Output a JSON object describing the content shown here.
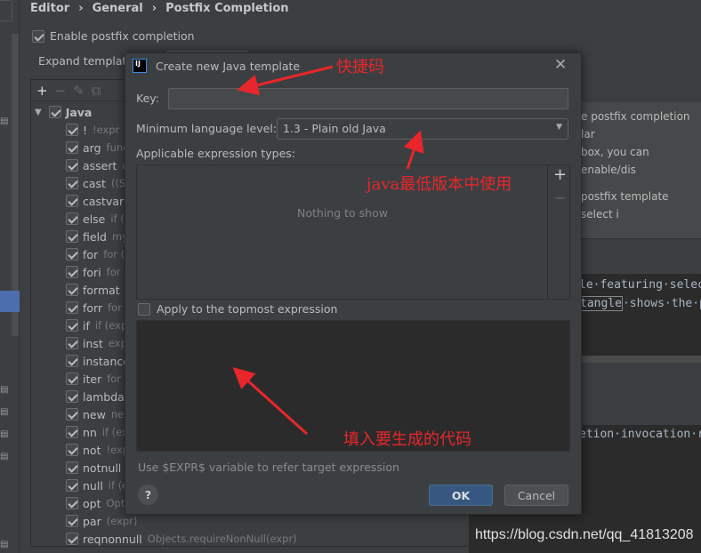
{
  "breadcrumb": [
    "Editor",
    "General",
    "Postfix Completion"
  ],
  "settings": {
    "enable_label": "Enable postfix completion",
    "enable_checked": true,
    "expand_label": "Expand template"
  },
  "tree": {
    "root": "Java",
    "items": [
      {
        "key": "!",
        "desc": "!expr"
      },
      {
        "key": "arg",
        "desc": "func"
      },
      {
        "key": "assert",
        "desc": "a"
      },
      {
        "key": "cast",
        "desc": "((Sc"
      },
      {
        "key": "castvar",
        "desc": "T"
      },
      {
        "key": "else",
        "desc": "if (!e"
      },
      {
        "key": "field",
        "desc": "my"
      },
      {
        "key": "for",
        "desc": "for (T"
      },
      {
        "key": "fori",
        "desc": "for ("
      },
      {
        "key": "format",
        "desc": "S"
      },
      {
        "key": "forr",
        "desc": "for ("
      },
      {
        "key": "if",
        "desc": "if (expr"
      },
      {
        "key": "inst",
        "desc": "expr"
      },
      {
        "key": "instanceof",
        "desc": ""
      },
      {
        "key": "iter",
        "desc": "for ("
      },
      {
        "key": "lambda",
        "desc": ""
      },
      {
        "key": "new",
        "desc": "new"
      },
      {
        "key": "nn",
        "desc": "if (exp"
      },
      {
        "key": "not",
        "desc": "!expr"
      },
      {
        "key": "notnull",
        "desc": "i"
      },
      {
        "key": "null",
        "desc": "if (ex"
      },
      {
        "key": "opt",
        "desc": "Opti"
      },
      {
        "key": "par",
        "desc": "(expr)"
      },
      {
        "key": "reqnonnull",
        "desc": "Objects.requireNonNull(expr)"
      }
    ]
  },
  "description": {
    "lines": [
      "e postfix completion lar",
      "box, you can enable/dis",
      "",
      "postfix template select i"
    ]
  },
  "preview": {
    "line1": "le·featuring·selec",
    "line2_boxed": "tangle",
    "line2_rest": "·shows·the·p",
    "line3": "etion·invocation·r"
  },
  "dialog": {
    "title": "Create new Java template",
    "key_label": "Key:",
    "key_value": "",
    "level_label": "Minimum language level:",
    "level_value": "1.3 - Plain old Java",
    "types_label": "Applicable expression types:",
    "types_empty": "Nothing to show",
    "apply_label": "Apply to the topmost expression",
    "apply_checked": false,
    "hint": "Use $EXPR$ variable to refer target expression",
    "ok": "OK",
    "cancel": "Cancel",
    "help": "?"
  },
  "annotations": {
    "key": "快捷码",
    "level": "java最低版本中使用",
    "code": "填入要生成的代码"
  },
  "watermark": "https://blog.csdn.net/qq_41813208",
  "colors": {
    "accent": "#365880",
    "selection": "#4b6eaf",
    "annotation": "#e8262b"
  }
}
